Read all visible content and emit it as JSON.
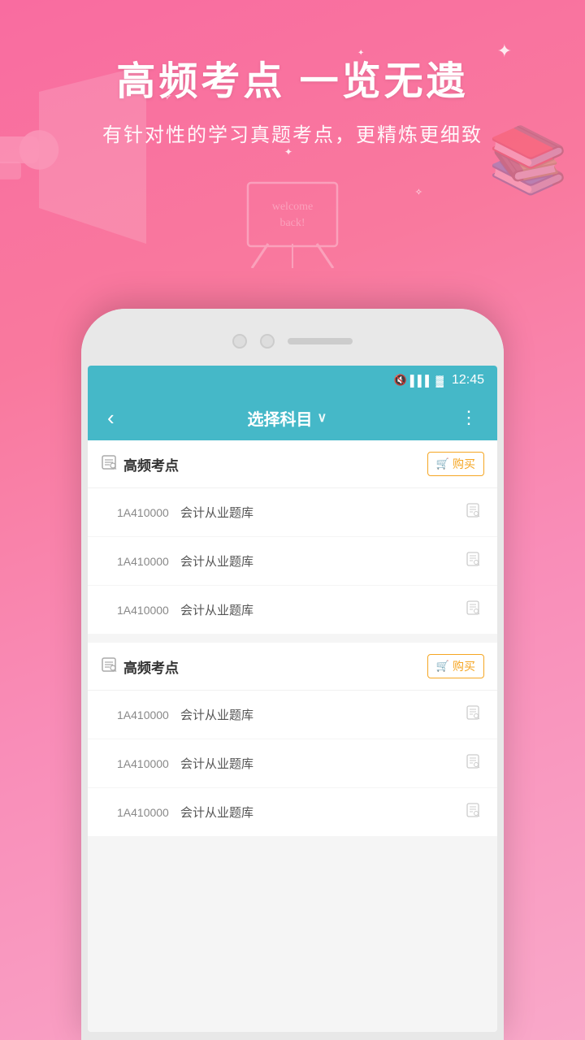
{
  "background": {
    "title": "高频考点 一览无遗",
    "subtitle": "有针对性的学习真题考点，更精炼更细致",
    "welcome_text": "welcome back!",
    "gradient_start": "#f96ca0",
    "gradient_end": "#f9a8c9"
  },
  "status_bar": {
    "time": "12:45",
    "mute_icon": "🔇",
    "signal_icon": "📶",
    "battery_icon": "🔋"
  },
  "toolbar": {
    "back_label": "‹",
    "title": "选择科目",
    "chevron": "∨",
    "more_label": "⋮"
  },
  "sections": [
    {
      "id": "section1",
      "title": "高频考点",
      "buy_label": "购买",
      "items": [
        {
          "code": "1A410000",
          "name": "会计从业题库"
        },
        {
          "code": "1A410000",
          "name": "会计从业题库"
        },
        {
          "code": "1A410000",
          "name": "会计从业题库"
        }
      ]
    },
    {
      "id": "section2",
      "title": "高频考点",
      "buy_label": "购买",
      "items": [
        {
          "code": "1A410000",
          "name": "会计从业题库"
        },
        {
          "code": "1A410000",
          "name": "会计从业题库"
        },
        {
          "code": "1A410000",
          "name": "会计从业题库"
        }
      ]
    }
  ]
}
